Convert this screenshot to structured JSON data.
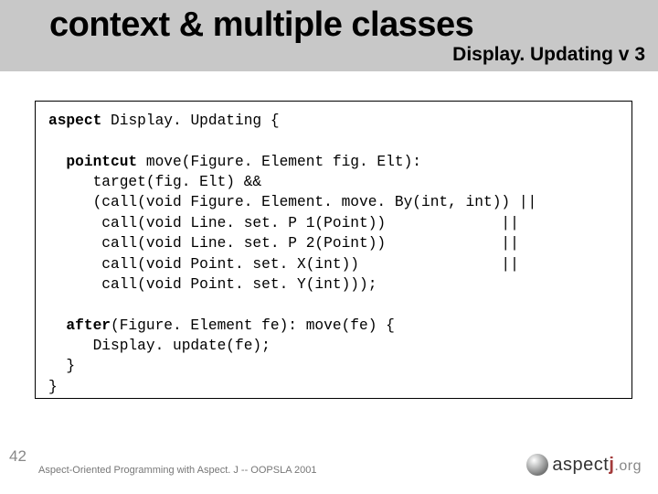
{
  "title": "context & multiple classes",
  "subtitle": "Display. Updating v 3",
  "code": {
    "l1a": "aspect",
    "l1b": " Display. Updating {",
    "blank1": "",
    "l2a": "  pointcut",
    "l2b": " move(Figure. Element fig. Elt):",
    "l3": "     target(fig. Elt) &&",
    "l4": "     (call(void Figure. Element. move. By(int, int)) ||",
    "l5": "      call(void Line. set. P 1(Point))             ||",
    "l6": "      call(void Line. set. P 2(Point))             ||",
    "l7": "      call(void Point. set. X(int))                ||",
    "l8": "      call(void Point. set. Y(int)));",
    "blank2": "",
    "l9a": "  after",
    "l9b": "(Figure. Element fe): move(fe) {",
    "l10": "     Display. update(fe);",
    "l11": "  }",
    "l12": "}"
  },
  "slide_number": "42",
  "footer": "Aspect-Oriented Programming with Aspect. J -- OOPSLA 2001",
  "logo": {
    "a": "aspect",
    "j": "j",
    "org": ".org"
  }
}
